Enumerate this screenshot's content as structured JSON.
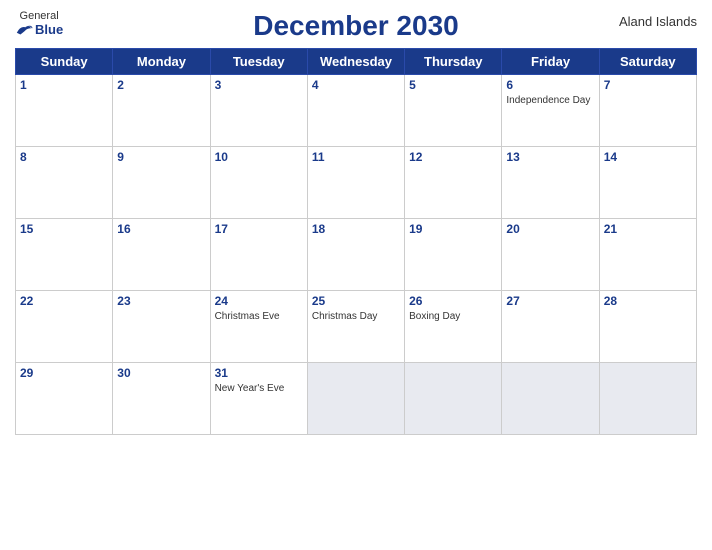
{
  "header": {
    "logo_general": "General",
    "logo_blue": "Blue",
    "title": "December 2030",
    "region": "Aland Islands"
  },
  "weekdays": [
    "Sunday",
    "Monday",
    "Tuesday",
    "Wednesday",
    "Thursday",
    "Friday",
    "Saturday"
  ],
  "weeks": [
    [
      {
        "day": "1",
        "event": ""
      },
      {
        "day": "2",
        "event": ""
      },
      {
        "day": "3",
        "event": ""
      },
      {
        "day": "4",
        "event": ""
      },
      {
        "day": "5",
        "event": ""
      },
      {
        "day": "6",
        "event": "Independence Day"
      },
      {
        "day": "7",
        "event": ""
      }
    ],
    [
      {
        "day": "8",
        "event": ""
      },
      {
        "day": "9",
        "event": ""
      },
      {
        "day": "10",
        "event": ""
      },
      {
        "day": "11",
        "event": ""
      },
      {
        "day": "12",
        "event": ""
      },
      {
        "day": "13",
        "event": ""
      },
      {
        "day": "14",
        "event": ""
      }
    ],
    [
      {
        "day": "15",
        "event": ""
      },
      {
        "day": "16",
        "event": ""
      },
      {
        "day": "17",
        "event": ""
      },
      {
        "day": "18",
        "event": ""
      },
      {
        "day": "19",
        "event": ""
      },
      {
        "day": "20",
        "event": ""
      },
      {
        "day": "21",
        "event": ""
      }
    ],
    [
      {
        "day": "22",
        "event": ""
      },
      {
        "day": "23",
        "event": ""
      },
      {
        "day": "24",
        "event": "Christmas Eve"
      },
      {
        "day": "25",
        "event": "Christmas Day"
      },
      {
        "day": "26",
        "event": "Boxing Day"
      },
      {
        "day": "27",
        "event": ""
      },
      {
        "day": "28",
        "event": ""
      }
    ],
    [
      {
        "day": "29",
        "event": ""
      },
      {
        "day": "30",
        "event": ""
      },
      {
        "day": "31",
        "event": "New Year's Eve"
      },
      {
        "day": "",
        "event": ""
      },
      {
        "day": "",
        "event": ""
      },
      {
        "day": "",
        "event": ""
      },
      {
        "day": "",
        "event": ""
      }
    ]
  ]
}
